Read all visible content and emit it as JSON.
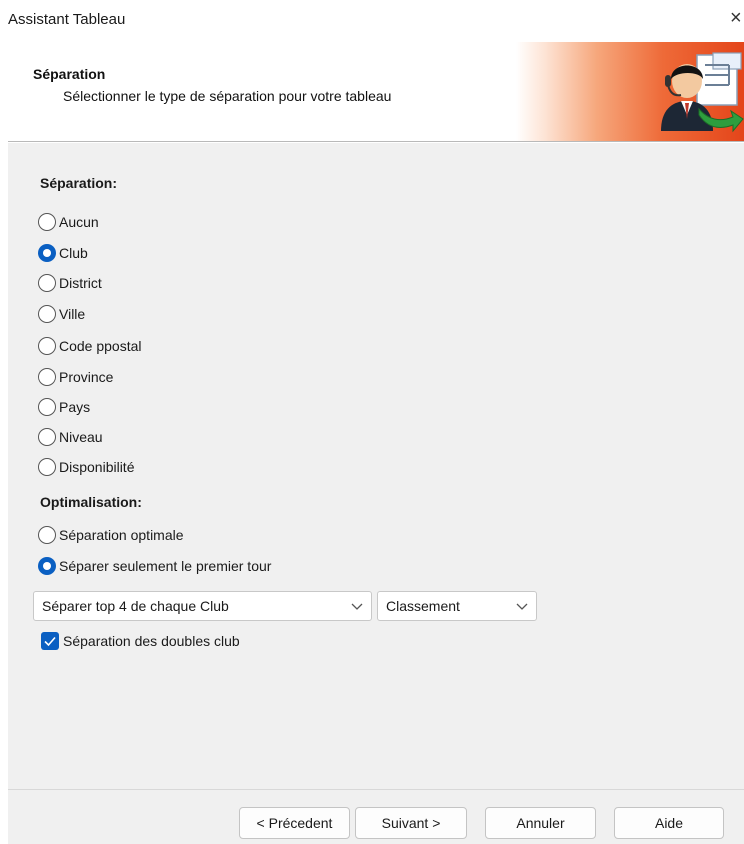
{
  "window": {
    "title": "Assistant Tableau",
    "close_glyph": "×"
  },
  "header": {
    "heading": "Séparation",
    "subheading": "Sélectionner le type de séparation pour votre tableau",
    "icon": "wizard-person-icon"
  },
  "separation": {
    "label": "Séparation:",
    "options": [
      "Aucun",
      "Club",
      "District",
      "Ville",
      "Code ppostal",
      "Province",
      "Pays",
      "Niveau",
      "Disponibilité"
    ],
    "selected": "Club"
  },
  "optimisation": {
    "label": "Optimalisation:",
    "options": [
      "Séparation optimale",
      "Séparer seulement le premier tour"
    ],
    "selected": "Séparer seulement le premier tour"
  },
  "dropdowns": {
    "top_value": "Séparer top 4 de chaque Club",
    "ranking_value": "Classement"
  },
  "double_club": {
    "label": "Séparation des doubles club",
    "checked": true
  },
  "buttons": {
    "previous": "< Précedent",
    "next": "Suivant >",
    "cancel": "Annuler",
    "help": "Aide"
  },
  "colors": {
    "accent": "#0a5fc2",
    "banner_orange": "#e4451a",
    "panel": "#f0f0f0"
  }
}
